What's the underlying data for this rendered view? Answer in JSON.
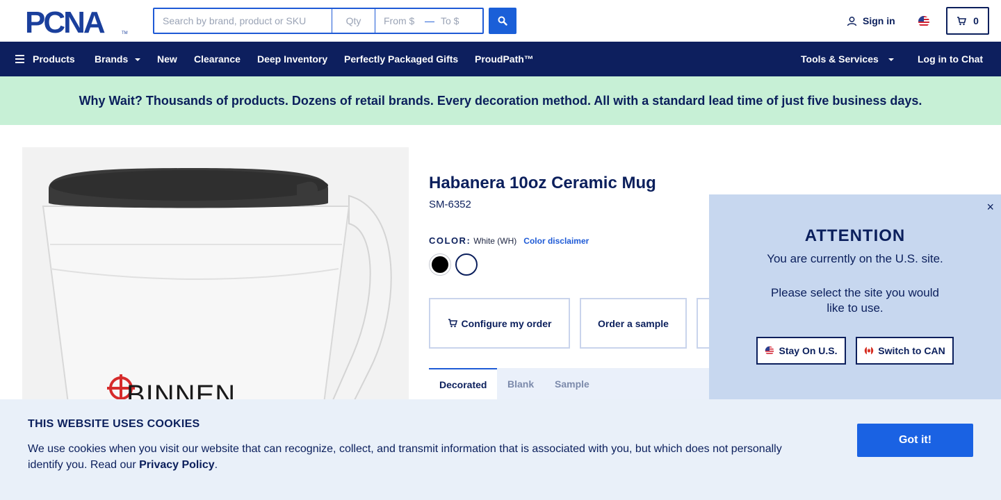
{
  "header": {
    "logo_text": "PCNA",
    "logo_mark": "TM",
    "search_placeholder": "Search by brand, product or SKU",
    "qty_placeholder": "Qty",
    "from_placeholder": "From $",
    "dash": "—",
    "to_placeholder": "To $",
    "sign_in": "Sign in",
    "cart_count": "0"
  },
  "nav": {
    "products": "Products",
    "brands": "Brands",
    "new": "New",
    "clearance": "Clearance",
    "deep_inventory": "Deep Inventory",
    "gifts": "Perfectly Packaged Gifts",
    "proudpath": "ProudPath™",
    "tools": "Tools & Services",
    "chat": "Log in to Chat"
  },
  "banner": {
    "text": "Why Wait? Thousands of products. Dozens of retail brands. Every decoration method. All with a standard lead time of just five business days."
  },
  "product": {
    "title": "Habanera 10oz Ceramic Mug",
    "sku": "SM-6352",
    "color_label": "COLOR:",
    "color_value": "White (WH)",
    "color_disclaimer": "Color disclaimer",
    "configure": "Configure my order",
    "sample": "Order a sample",
    "imprint_text": "BINNEN",
    "tabs": [
      "Decorated",
      "Blank",
      "Sample"
    ]
  },
  "popup": {
    "heading": "ATTENTION",
    "line1": "You are currently on the U.S. site.",
    "line2": "Please select the site you would",
    "line3": "like to use.",
    "stay": "Stay On U.S.",
    "switch": "Switch to CAN",
    "close": "×"
  },
  "cookie": {
    "title": "THIS WEBSITE USES COOKIES",
    "text": "We use cookies when you visit our website that can recognize, collect, and transmit information that is associated with you, but which does not personally identify you. Read our ",
    "link": "Privacy Policy",
    "end": ".",
    "button": "Got it!"
  },
  "colors": {
    "navy": "#0d1f5e",
    "accent_blue": "#1a62e3",
    "banner_green": "#c7f0d6",
    "popup_bg": "#c7d7ef",
    "cookie_bg": "#e9f0f9"
  }
}
